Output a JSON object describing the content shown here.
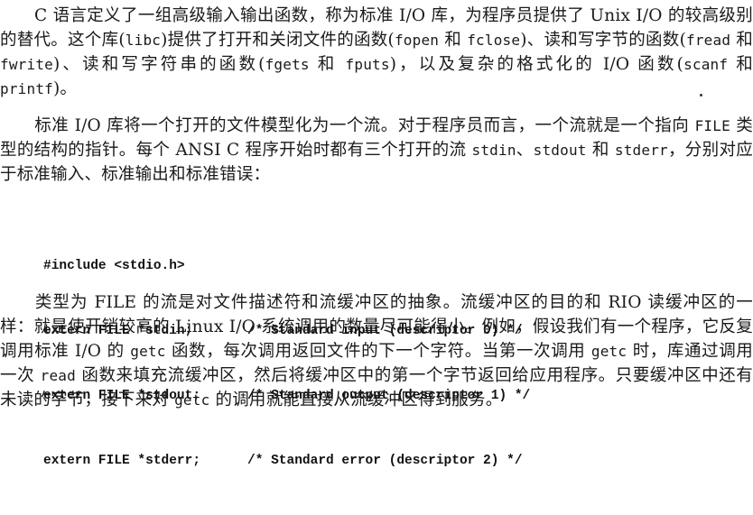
{
  "paragraph1": {
    "s1": "C 语言定义了一组高级输入输出函数，称为标准 I/O 库，为程序员提供了 Unix I/O 的较高级别的替代。这个库(",
    "libc": "libc",
    "s2": ")提供了打开和关闭文件的函数(",
    "fopen": "fopen",
    "s3": " 和 ",
    "fclose": "fclose",
    "s4": ")、读和写字节的函数(",
    "fread": "fread",
    "s5": " 和 ",
    "fwrite": "fwrite",
    "s6": ")、读和写字符串的函数(",
    "fgets": "fgets",
    "s7": " 和 ",
    "fputs": "fputs",
    "s8": ")，以及复杂的格式化的 I/O 函数(",
    "scanf": "scanf",
    "s9": " 和 ",
    "printf": "printf",
    "s10": ")。"
  },
  "paragraph2": {
    "s1": "标准 I/O 库将一个打开的文件模型化为一个流。对于程序员而言，一个流就是一个指向 ",
    "file": "FILE",
    "s2": " 类型的结构的指针。每个 ANSI C 程序开始时都有三个打开的流 ",
    "stdin": "stdin",
    "s3": "、",
    "stdout": "stdout",
    "s4": " 和 ",
    "stderr": "stderr",
    "s5": "，分别对应于标准输入、标准输出和标准错误："
  },
  "code": {
    "include": "#include <stdio.h>",
    "lines": [
      {
        "decl": "extern FILE *stdin;",
        "comment": "/* Standard input (descriptor 0) */"
      },
      {
        "decl": "extern FILE *stdout;",
        "comment": "/* Standard output (descriptor 1) */"
      },
      {
        "decl": "extern FILE *stderr;",
        "comment": "/* Standard error (descriptor 2) */"
      }
    ]
  },
  "paragraph3": {
    "s1": "类型为 FILE 的流是对文件描述符和流缓冲区的抽象。流缓冲区的目的和 RIO 读缓冲区的一样：就是使开销较高的 Linux I/O 系统调用的数量尽可能得小。例如，假设我们有一个程序，它反复调用标准 I/O 的 ",
    "getc1": "getc",
    "s2": " 函数，每次调用返回文件的下一个字符。当第一次调用 ",
    "getc2": "getc",
    "s3": " 时，库通过调用一次 ",
    "read": "read",
    "s4": " 函数来填充流缓冲区，然后将缓冲区中的第一个字节返回给应用程序。只要缓冲区中还有未读的字节，接下来对 ",
    "getc3": "getc",
    "s5": " 的调用就能直接从流缓冲区得到服务。"
  }
}
